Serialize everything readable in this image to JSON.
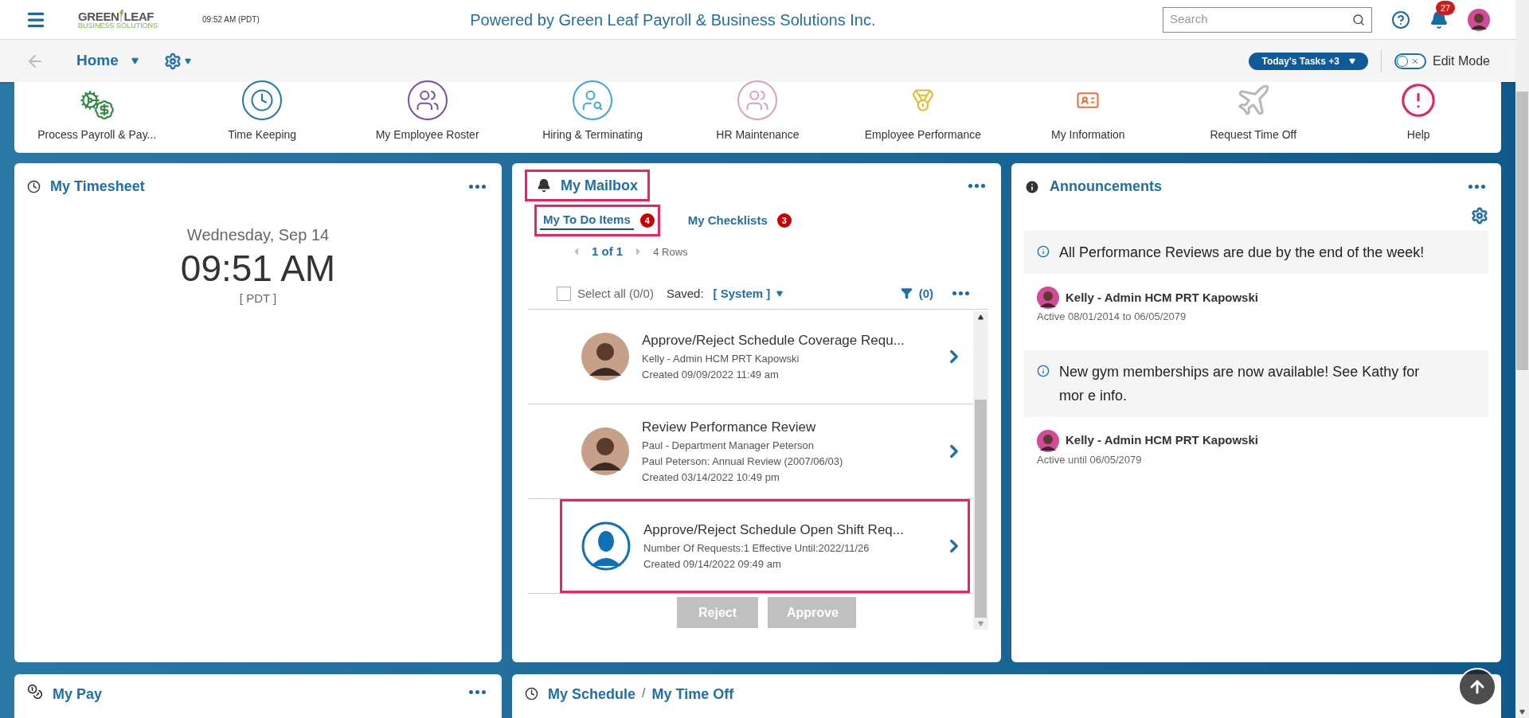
{
  "header": {
    "logo": {
      "top_left": "GREEN",
      "top_right": "LEAF",
      "bottom": "BUSINESS SOLUTIONS"
    },
    "time": "09:52 AM (PDT)",
    "title": "Powered by Green Leaf Payroll & Business Solutions Inc.",
    "search": {
      "placeholder": "Search"
    },
    "notifications": "27"
  },
  "nav": {
    "home": "Home",
    "tasks": "Today's Tasks +3",
    "edit_mode": {
      "label": "Edit Mode",
      "on": false
    }
  },
  "shortcuts": [
    {
      "label": "Process Payroll & Pay...",
      "kind": "payroll",
      "color": "#2e8b3e"
    },
    {
      "label": "Time Keeping",
      "kind": "clock",
      "color": "#1f78b4"
    },
    {
      "label": "My Employee Roster",
      "kind": "roster",
      "color": "#7b4ea3"
    },
    {
      "label": "Hiring & Terminating",
      "kind": "hiring",
      "color": "#3aa6dd"
    },
    {
      "label": "HR Maintenance",
      "kind": "roster",
      "color": "#d9a0c0"
    },
    {
      "label": "Employee Performance",
      "kind": "medal",
      "color": "#e8b923"
    },
    {
      "label": "My Information",
      "kind": "idcard",
      "color": "#f26b3a"
    },
    {
      "label": "Request Time Off",
      "kind": "plane",
      "color": "#b8b8b8"
    },
    {
      "label": "Help",
      "kind": "help",
      "color": "#e3245a"
    }
  ],
  "timesheet": {
    "title": "My Timesheet",
    "date": "Wednesday, Sep 14",
    "time": "09:51 AM",
    "zone": "[ PDT ]"
  },
  "mailbox": {
    "title": "My Mailbox",
    "highlighted": true,
    "tabs": [
      {
        "label": "My To Do Items",
        "count": "4",
        "selected": true,
        "highlighted": true
      },
      {
        "label": "My Checklists",
        "count": "3",
        "selected": false,
        "highlighted": false
      }
    ],
    "pager": "1 of 1",
    "rows": "4 Rows",
    "select_all": {
      "label": "Select all (0/0)",
      "checked": false
    },
    "saved_label": "Saved:",
    "saved_value": "[ System ]",
    "filter": "(0)",
    "items": [
      {
        "title": "Approve/Reject Schedule Coverage Requ...",
        "lines": [
          "Kelly - Admin HCM PRT Kapowski",
          "Created 09/09/2022 11:49 am"
        ],
        "kind": "photo",
        "highlighted": false
      },
      {
        "title": "Review Performance Review",
        "lines": [
          "Paul - Department Manager Peterson",
          "Paul Peterson: Annual Review (2007/06/03)",
          "Created 03/14/2022 10:49 pm"
        ],
        "kind": "photo",
        "highlighted": false
      },
      {
        "title": "Approve/Reject Schedule Open Shift Req...",
        "lines": [
          "Number Of Requests:1 Effective Until:2022/11/26",
          "Created 09/14/2022 09:49 am"
        ],
        "kind": "placeholder",
        "highlighted": true
      }
    ],
    "buttons": [
      {
        "label": "Reject",
        "disabled": true
      },
      {
        "label": "Approve",
        "disabled": true
      }
    ]
  },
  "announcements": {
    "title": "Announcements",
    "items": [
      {
        "message": "All Performance Reviews are due by the end of the week!",
        "author": "Kelly - Admin HCM PRT Kapowski",
        "period": "Active 08/01/2014 to 06/05/2079"
      },
      {
        "message": "New gym memberships are now available! See Kathy for mor e info.",
        "author": "Kelly - Admin HCM PRT Kapowski",
        "period": "Active until 06/05/2079"
      }
    ]
  },
  "bottom": {
    "pay": "My Pay",
    "schedule": "My Schedule",
    "separator": "/",
    "time_off": "My Time Off"
  }
}
